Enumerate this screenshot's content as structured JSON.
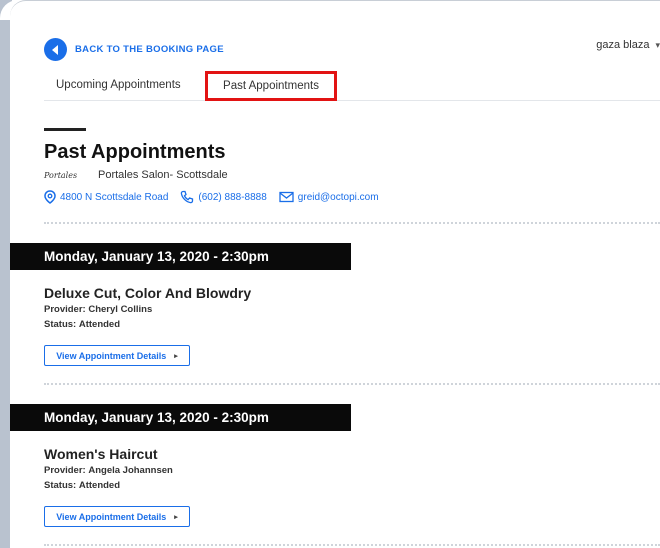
{
  "header": {
    "back_label": "BACK TO THE BOOKING PAGE",
    "user_name": "gaza blaza",
    "user_chevron": "▾"
  },
  "tabs": {
    "upcoming": "Upcoming Appointments",
    "past": "Past Appointments",
    "active": "past"
  },
  "salon": {
    "page_title": "Past Appointments",
    "logo_text": "Portales",
    "name": "Portales Salon- Scottsdale",
    "address": "4800 N Scottsdale Road",
    "phone": "(602) 888-8888",
    "email": "greid@octopi.com"
  },
  "appointments": [
    {
      "date": "Monday, January 13, 2020 - 2:30pm",
      "service": "Deluxe Cut, Color And Blowdry",
      "provider_label": "Provider:",
      "provider": "Cheryl Collins",
      "status_label": "Status:",
      "status": "Attended",
      "details_label": "View Appointment Details",
      "details_arrow": "▸"
    },
    {
      "date": "Monday, January 13, 2020 - 2:30pm",
      "service": "Women's Haircut",
      "provider_label": "Provider:",
      "provider": "Angela Johannsen",
      "status_label": "Status:",
      "status": "Attended",
      "details_label": "View Appointment Details",
      "details_arrow": "▸"
    }
  ],
  "colors": {
    "accent": "#1a6ee8",
    "highlight_box": "#e21313",
    "date_bar": "#0a0a0a"
  },
  "icons": [
    "chevron-left-icon",
    "location-pin-icon",
    "phone-icon",
    "email-icon",
    "chevron-down-icon",
    "arrow-right-icon"
  ]
}
